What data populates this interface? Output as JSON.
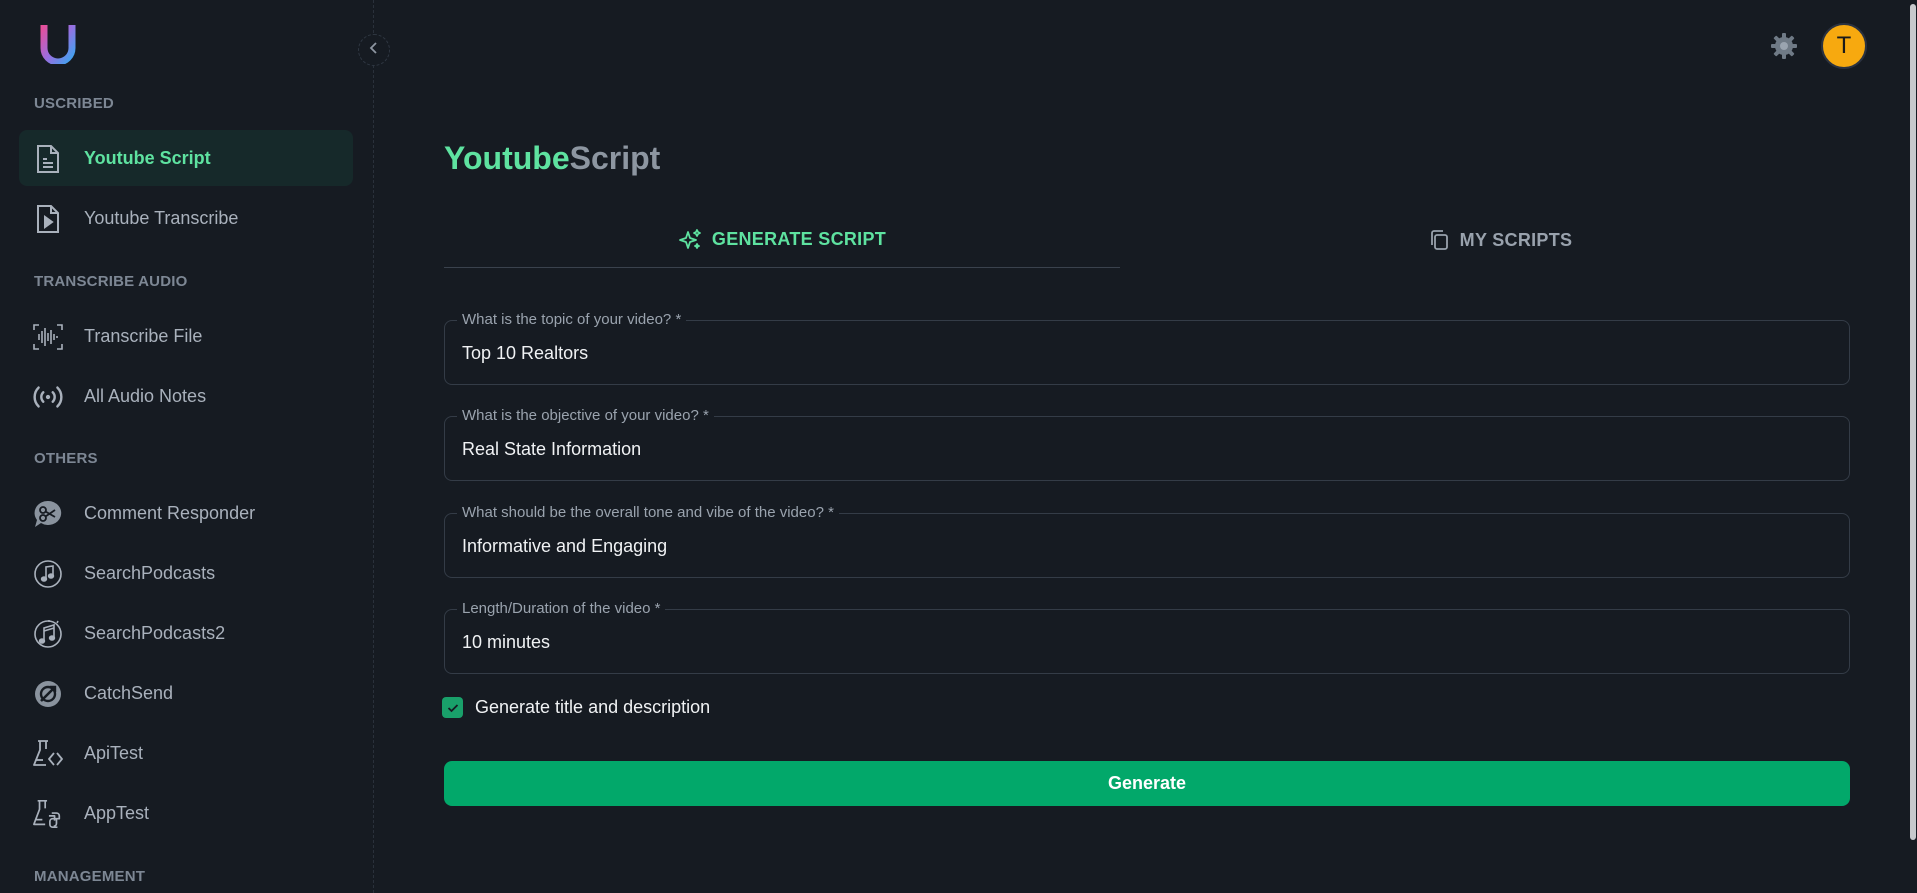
{
  "sidebar": {
    "collapse_icon": "chevron-left-icon",
    "sections": {
      "uscribed": "USCRIBED",
      "transcribe_audio": "TRANSCRIBE AUDIO",
      "others": "OTHERS",
      "management": "MANAGEMENT"
    },
    "items": [
      {
        "label": "Youtube Script",
        "icon": "document-icon",
        "active": true
      },
      {
        "label": "Youtube Transcribe",
        "icon": "file-play-icon",
        "active": false
      },
      {
        "label": "Transcribe File",
        "icon": "waveform-icon",
        "active": false
      },
      {
        "label": "All Audio Notes",
        "icon": "broadcast-icon",
        "active": false
      },
      {
        "label": "Comment Responder",
        "icon": "comment-scissors-icon",
        "active": false
      },
      {
        "label": "SearchPodcasts",
        "icon": "music-note-icon",
        "active": false
      },
      {
        "label": "SearchPodcasts2",
        "icon": "music-notes-icon",
        "active": false
      },
      {
        "label": "CatchSend",
        "icon": "catch-send-icon",
        "active": false
      },
      {
        "label": "ApiTest",
        "icon": "flask-code-icon",
        "active": false
      },
      {
        "label": "AppTest",
        "icon": "flask-python-icon",
        "active": false
      }
    ]
  },
  "header": {
    "settings_icon": "gear-icon",
    "avatar_initial": "T"
  },
  "page": {
    "title_part1": "Youtube",
    "title_part2": "Script"
  },
  "tabs": [
    {
      "label": "GENERATE SCRIPT",
      "icon": "sparkles-icon",
      "active": true
    },
    {
      "label": "MY SCRIPTS",
      "icon": "copy-icon",
      "active": false
    }
  ],
  "form": {
    "fields": [
      {
        "label": "What is the topic of your video? *",
        "value": "Top 10 Realtors"
      },
      {
        "label": "What is the objective of your video? *",
        "value": "Real State Information"
      },
      {
        "label": "What should be the overall tone and vibe of the video? *",
        "value": "Informative and Engaging"
      },
      {
        "label": "Length/Duration of the video *",
        "value": "10 minutes"
      }
    ],
    "checkbox_label": "Generate title and description",
    "checkbox_checked": true,
    "submit_label": "Generate"
  },
  "colors": {
    "accent": "#5ee2a0",
    "button": "#02a86a",
    "avatar": "#f7a90f",
    "background": "#161b22"
  }
}
